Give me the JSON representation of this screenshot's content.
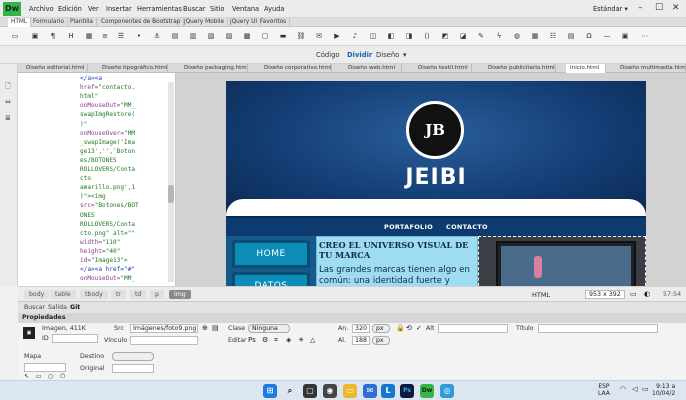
{
  "app": {
    "logo": "Dw",
    "menu": [
      "Archivo",
      "Edición",
      "Ver",
      "Insertar",
      "Herramientas",
      "Buscar",
      "Sitio",
      "Ventana",
      "Ayuda"
    ],
    "workspace": "Estándar"
  },
  "insert_tabs": [
    "HTML",
    "Formulario",
    "Plantilla",
    "Componentes de Bootstrap",
    "jQuery Mobile",
    "jQuery UI",
    "Favoritos"
  ],
  "view_switch": {
    "code": "Código",
    "split": "Dividir",
    "design": "Diseño"
  },
  "file_tabs": [
    "Diseño editorial.html",
    "Diseño tipográfico.html",
    "Diseño packaging.html",
    "Diseño corporativo.html",
    "Diseño web.html",
    "Diseño textil.html",
    "Diseño publicitario.html",
    "Inicio.html",
    "Diseño multimedia.html"
  ],
  "code_lines": [
    {
      "a": "",
      "t": "</a><a",
      "v": ""
    },
    {
      "a": "href=",
      "t": "",
      "v": "\"contacto."
    },
    {
      "a": "",
      "t": "",
      "v": "html\""
    },
    {
      "a": "onMouseOut=",
      "t": "",
      "v": "\"MM_"
    },
    {
      "a": "",
      "t": "",
      "v": "swapImgRestore("
    },
    {
      "a": "",
      "t": "",
      "v": ")\""
    },
    {
      "a": "onMouseOver=",
      "t": "",
      "v": "\"MM"
    },
    {
      "a": "",
      "t": "",
      "v": "_swapImage('Ima"
    },
    {
      "a": "",
      "t": "",
      "v": "ge13','','Boton"
    },
    {
      "a": "",
      "t": "",
      "v": "es/BOTONES"
    },
    {
      "a": "",
      "t": "",
      "v": "ROLLOVERS/Conta"
    },
    {
      "a": "",
      "t": "",
      "v": "cto"
    },
    {
      "a": "",
      "t": "",
      "v": "amarillo.png',1"
    },
    {
      "a": "",
      "t": "",
      "v": ")\"><img"
    },
    {
      "a": "src=",
      "t": "",
      "v": "\"Botones/BOT"
    },
    {
      "a": "",
      "t": "",
      "v": "ONES"
    },
    {
      "a": "",
      "t": "",
      "v": "ROLLOVERS/Conta"
    },
    {
      "a": "",
      "t": "",
      "v": "cto.png\" alt=\"\""
    },
    {
      "a": "width=",
      "t": "",
      "v": "\"110\""
    },
    {
      "a": "height=",
      "t": "",
      "v": "\"40\""
    },
    {
      "a": "id=",
      "t": "",
      "v": "\"Image13\">"
    },
    {
      "a": "",
      "t": "</a><a href=\"#\"",
      "v": ""
    },
    {
      "a": "onMouseOut=",
      "t": "",
      "v": "\"MM_"
    }
  ],
  "site": {
    "brand": "JEIBI",
    "emblem": "JB",
    "nav": [
      "PORTAFOLIO",
      "CONTACTO"
    ],
    "buttons": [
      "HOME",
      "DATOS"
    ],
    "heading": "CREO EL UNIVERSO VISUAL DE TU MARCA",
    "paragraph": "Las grandes marcas tienen algo en común: una identidad fuerte y"
  },
  "tag_selector": [
    "body",
    "table",
    "tbody",
    "tr",
    "td",
    "p",
    "img"
  ],
  "status": {
    "lang": "HTML",
    "size": "953 x 392",
    "kb": "57:54"
  },
  "panel_tabs": [
    "Buscar",
    "Salida",
    "Git"
  ],
  "properties": {
    "title": "Propiedades",
    "img_info": "Imagen, 411K",
    "id_label": "ID",
    "src_label": "Src",
    "src_value": "Imágenes/foto9.png",
    "link_label": "Vínculo",
    "class_label": "Clase",
    "class_value": "Ninguna",
    "edit_label": "Editar",
    "w_label": "An.",
    "w_value": "320",
    "h_label": "Al.",
    "h_value": "188",
    "unit": "px",
    "alt_label": "Alt",
    "title_label": "Título",
    "map_label": "Mapa",
    "target_label": "Destino",
    "original_label": "Original"
  },
  "tray": {
    "lang1": "ESP",
    "lang2": "LAA",
    "time": "9:13 a",
    "date": "10/04/2"
  }
}
